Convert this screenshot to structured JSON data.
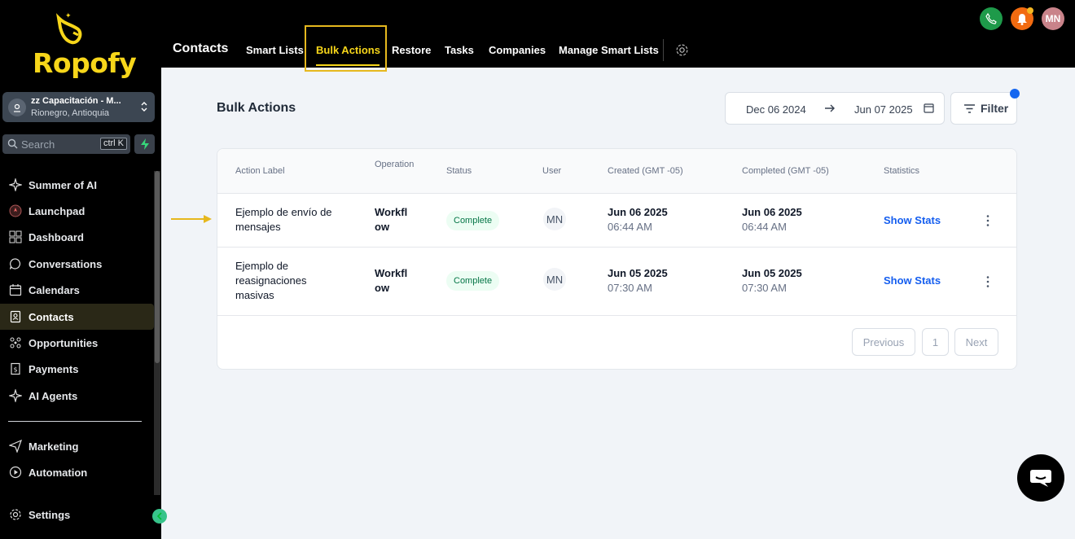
{
  "app": {
    "brand": "Ropofy"
  },
  "account": {
    "name": "zz Capacitación - M...",
    "location": "Rionegro, Antioquia"
  },
  "search": {
    "placeholder": "Search",
    "shortcut": "ctrl K"
  },
  "sidebar": {
    "items": [
      {
        "label": "Summer of AI",
        "icon": "sparkle-icon"
      },
      {
        "label": "Launchpad",
        "icon": "rocket-icon"
      },
      {
        "label": "Dashboard",
        "icon": "dashboard-icon"
      },
      {
        "label": "Conversations",
        "icon": "chat-bubble-icon"
      },
      {
        "label": "Calendars",
        "icon": "calendar-icon"
      },
      {
        "label": "Contacts",
        "icon": "contacts-icon",
        "active": true
      },
      {
        "label": "Opportunities",
        "icon": "opportunities-icon"
      },
      {
        "label": "Payments",
        "icon": "payments-icon"
      },
      {
        "label": "AI Agents",
        "icon": "sparkle-icon"
      },
      {
        "label": "Marketing",
        "icon": "send-icon"
      },
      {
        "label": "Automation",
        "icon": "automation-icon"
      }
    ],
    "settings_label": "Settings"
  },
  "topbar": {
    "title": "Contacts",
    "tabs": [
      "Smart Lists",
      "Bulk Actions",
      "Restore",
      "Tasks",
      "Companies",
      "Manage Smart Lists"
    ],
    "active_tab": "Bulk Actions",
    "avatar_initials": "MN"
  },
  "main": {
    "title": "Bulk Actions",
    "date_from": "Dec 06 2024",
    "date_to": "Jun 07 2025",
    "filter_label": "Filter",
    "columns": {
      "action_label": "Action Label",
      "operation": "Operation",
      "status": "Status",
      "user": "User",
      "created": "Created (GMT -05)",
      "completed": "Completed (GMT -05)",
      "statistics": "Statistics"
    },
    "rows": [
      {
        "label": "Ejemplo de envío de mensajes",
        "operation": "Workflow",
        "status": "Complete",
        "user": "MN",
        "created_date": "Jun 06 2025",
        "created_time": "06:44 AM",
        "completed_date": "Jun 06 2025",
        "completed_time": "06:44 AM",
        "stats_label": "Show Stats"
      },
      {
        "label": "Ejemplo de reasignaciones masivas",
        "operation": "Workflow",
        "status": "Complete",
        "user": "MN",
        "created_date": "Jun 05 2025",
        "created_time": "07:30 AM",
        "completed_date": "Jun 05 2025",
        "completed_time": "07:30 AM",
        "stats_label": "Show Stats"
      }
    ],
    "pagination": {
      "previous": "Previous",
      "page": "1",
      "next": "Next"
    }
  },
  "colors": {
    "brand": "#f7d61a",
    "link": "#155eef",
    "success_bg": "#ecfdf3",
    "success_text": "#067647"
  }
}
